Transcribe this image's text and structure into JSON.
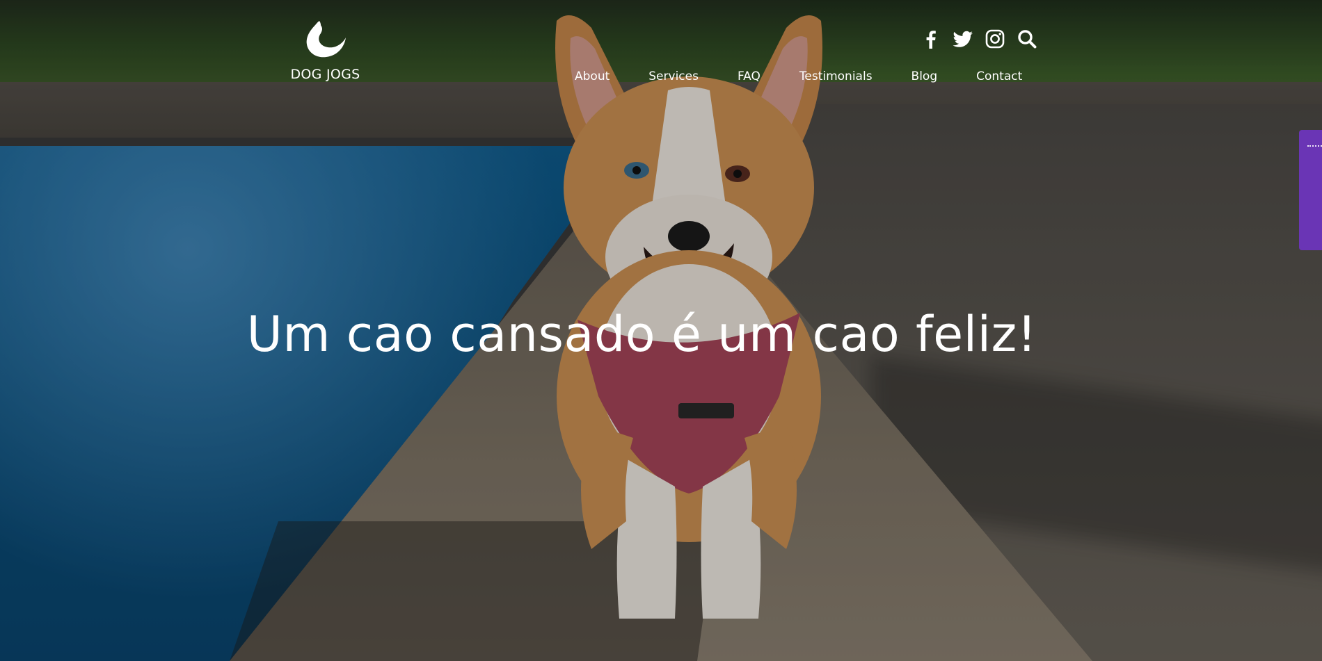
{
  "brand": {
    "name": "DOG JOGS",
    "logo_icon": "wave-drop-logo-icon"
  },
  "social": {
    "facebook_icon": "facebook-icon",
    "twitter_icon": "twitter-icon",
    "instagram_icon": "instagram-icon",
    "search_icon": "search-icon"
  },
  "nav": {
    "items": [
      {
        "label": "About"
      },
      {
        "label": "Services"
      },
      {
        "label": "FAQ"
      },
      {
        "label": "Testimonials"
      },
      {
        "label": "Blog"
      },
      {
        "label": "Contact"
      }
    ]
  },
  "hero": {
    "headline": "Um cao cansado é um cao feliz!"
  },
  "colors": {
    "text": "#ffffff",
    "side_tab": "#6a35b5"
  }
}
